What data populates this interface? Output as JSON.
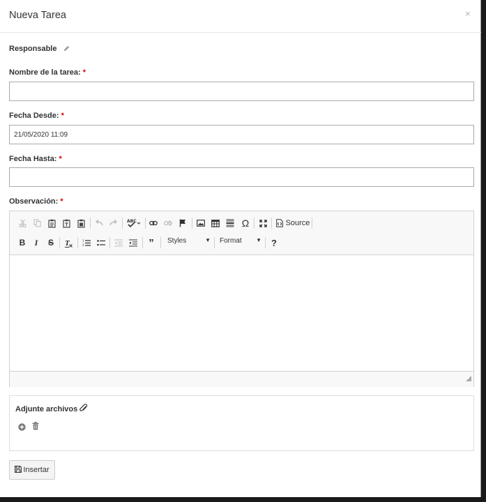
{
  "modal": {
    "title": "Nueva Tarea",
    "close_symbol": "×"
  },
  "form": {
    "responsable_label": "Responsable",
    "nombre_label": "Nombre de la tarea:",
    "fecha_desde_label": "Fecha Desde:",
    "fecha_desde_value": "21/05/2020 11:09",
    "fecha_hasta_label": "Fecha Hasta:",
    "observacion_label": "Observación:",
    "required_mark": "*"
  },
  "editor": {
    "source_label": "Source",
    "styles_label": "Styles",
    "format_label": "Format",
    "help_label": "?",
    "bold": "B",
    "italic": "I",
    "strike": "S",
    "spellcheck_label": "ABC"
  },
  "attachments": {
    "title": "Adjunte archivos"
  },
  "actions": {
    "insert_label": "Insertar"
  },
  "colors": {
    "required": "#dd0000",
    "border": "#aaaaaa",
    "toolbar_bg": "#f8f8f8"
  }
}
